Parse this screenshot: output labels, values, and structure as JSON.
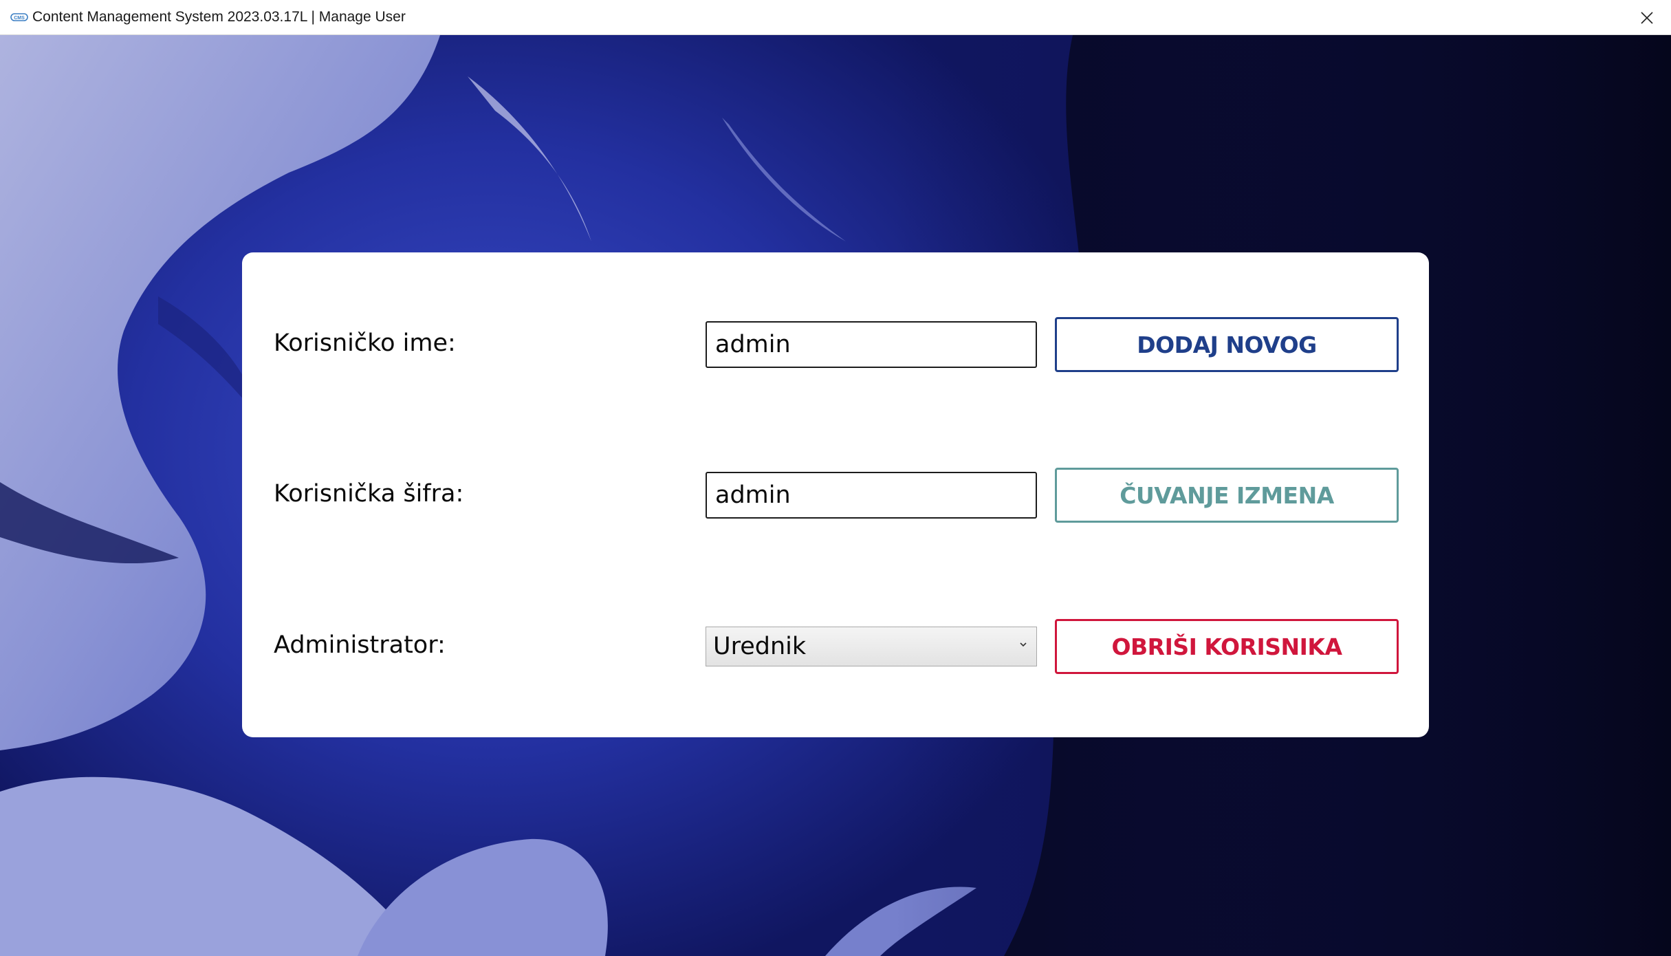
{
  "window": {
    "title": "Content Management System 2023.03.17L | Manage User",
    "app_icon": "cms-logo-icon",
    "close_icon": "close-icon"
  },
  "form": {
    "username_label": "Korisničko ime:",
    "username_value": "admin",
    "password_label": "Korisnička šifra:",
    "password_value": "admin",
    "role_label": "Administrator:",
    "role_selected": "Urednik",
    "role_dropdown_icon": "chevron-down-icon"
  },
  "actions": {
    "add_label": "DODAJ NOVOG",
    "add_color": "#1f3f8a",
    "save_label": "ČUVANJE IZMENA",
    "save_color": "#5f9b9b",
    "delete_label": "OBRIŠI KORISNIKA",
    "delete_color": "#d0163c"
  },
  "colors": {
    "background_dark": "#0b0d2e",
    "background_blue": "#2a3aa8",
    "panel": "#ffffff"
  }
}
